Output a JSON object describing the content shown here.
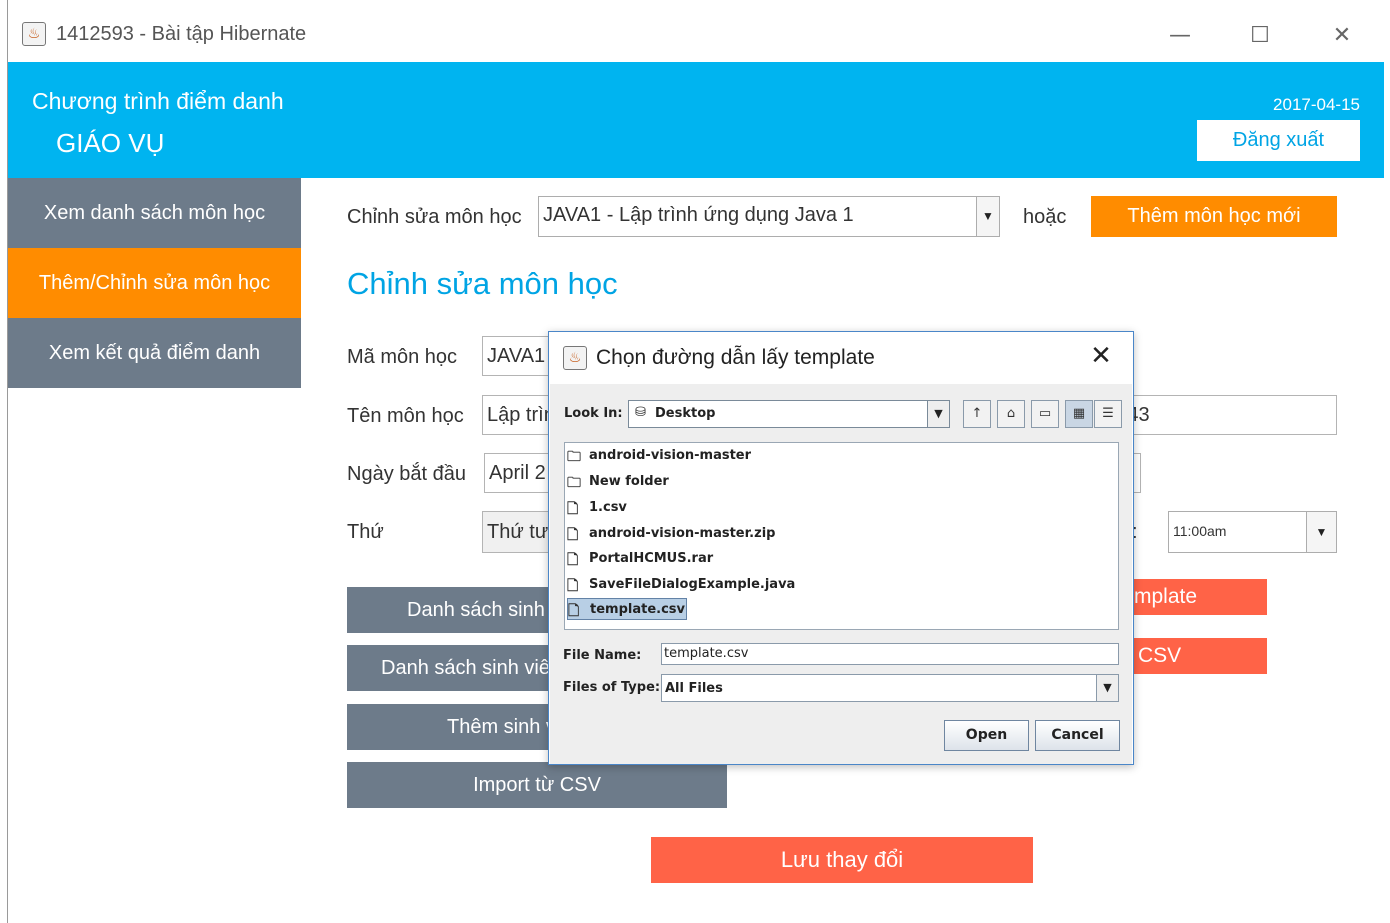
{
  "window": {
    "title": "1412593 - Bài tập Hibernate",
    "controls": [
      "—",
      "☐",
      "✕"
    ]
  },
  "header": {
    "app_title": "Chương trình điểm danh",
    "role": "GIÁO VỤ",
    "date": "2017-04-15",
    "logout_label": "Đăng xuất"
  },
  "sidebar": {
    "items": [
      {
        "label": "Xem danh sách môn học",
        "active": false
      },
      {
        "label": "Thêm/Chỉnh sửa môn học",
        "active": true
      },
      {
        "label": "Xem kết quả điểm danh",
        "active": false
      }
    ]
  },
  "main": {
    "edit_label": "Chỉnh sửa môn học",
    "course_select": "JAVA1 - Lập trình ứng dụng Java 1",
    "or_label": "hoặc",
    "add_new_label": "Thêm môn học mới",
    "section_title": "Chỉnh sửa môn học",
    "fields": {
      "code_label": "Mã môn học",
      "code_value": "JAVA1",
      "name_label": "Tên môn học",
      "name_value": "Lập trình ứng dụng Java 1",
      "room_value": "E43",
      "start_label": "Ngày bắt đầu",
      "start_value": "April 2",
      "day_label": "Thứ",
      "day_value": "Thứ tư",
      "time_value": "11:00am"
    },
    "buttons": {
      "student_list": "Danh sách sinh viên",
      "student_list_2": "Danh sách sinh viên",
      "add_student": "Thêm sinh viên",
      "import_csv": "Import từ CSV",
      "template_btn": "mplate",
      "csv_btn": "CSV",
      "save": "Lưu thay đổi"
    }
  },
  "dialog": {
    "title": "Chọn đường dẫn lấy template",
    "look_in_label": "Look In:",
    "look_in_value": "Desktop",
    "files": [
      {
        "name": "android-vision-master",
        "type": "folder"
      },
      {
        "name": "New folder",
        "type": "folder"
      },
      {
        "name": "1.csv",
        "type": "file"
      },
      {
        "name": "android-vision-master.zip",
        "type": "file"
      },
      {
        "name": "PortalHCMUS.rar",
        "type": "file"
      },
      {
        "name": "SaveFileDialogExample.java",
        "type": "file"
      },
      {
        "name": "template.csv",
        "type": "file",
        "selected": true
      }
    ],
    "file_name_label": "File Name:",
    "file_name_value": "template.csv",
    "file_type_label": "Files of Type:",
    "file_type_value": "All Files",
    "open_label": "Open",
    "cancel_label": "Cancel"
  },
  "colors": {
    "header_blue": "#00b4f0",
    "accent_orange": "#ff8c00",
    "sidebar_gray": "#6d7b8a",
    "red_button": "#ff6347",
    "title_blue": "#00a4e4"
  }
}
